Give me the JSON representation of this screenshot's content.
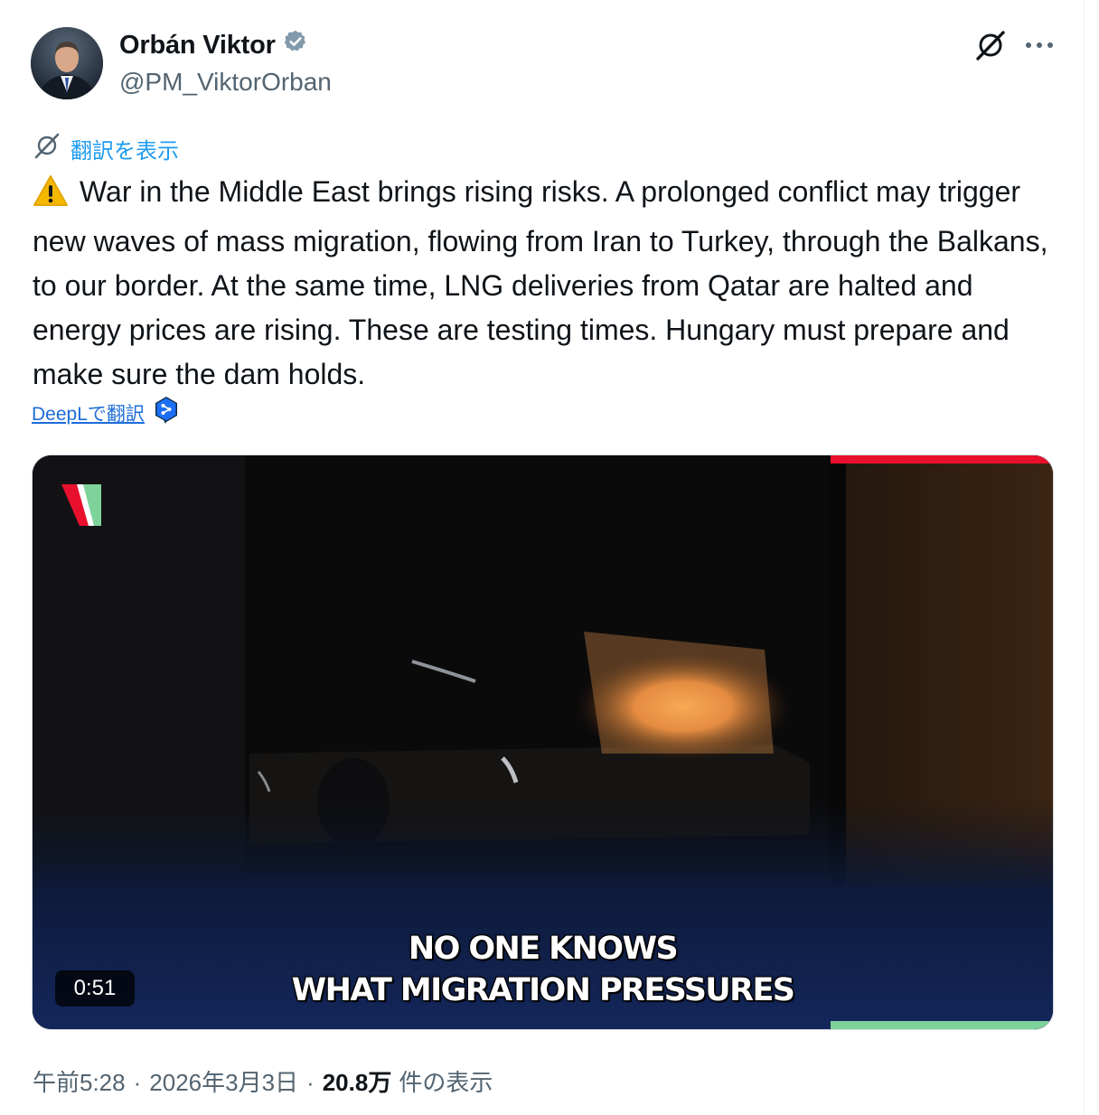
{
  "author": {
    "display_name": "Orbán Viktor",
    "handle": "@PM_ViktorOrban",
    "verified": true,
    "verified_color": "#829aab"
  },
  "header": {
    "grok_icon": "grok-icon",
    "more_icon": "more-dots-icon"
  },
  "translate": {
    "label": "翻訳を表示",
    "icon": "grok-icon"
  },
  "tweet": {
    "emoji": "warning-icon",
    "text": "War in the Middle East brings rising risks. A prolonged conflict may trigger new waves of mass migration, flowing from Iran to Turkey, through the Balkans, to our border. At the same time, LNG deliveries from Qatar are halted and energy prices are rising. These are testing times. Hungary must prepare and make sure the dam holds."
  },
  "deepl": {
    "label": "DeepLで翻訳",
    "icon": "deepl-icon"
  },
  "video": {
    "duration": "0:51",
    "caption_line1": "NO ONE KNOWS",
    "caption_line2": "WHAT MIGRATION PRESSURES",
    "accent_red": "#e8102c",
    "accent_green": "#7ed39a",
    "logo_icon": "channel-logo-icon"
  },
  "meta": {
    "time": "午前5:28",
    "date": "2026年3月3日",
    "views_count": "20.8万",
    "views_label": "件の表示",
    "separator": "·"
  },
  "colors": {
    "link_blue": "#1d9bf0",
    "secondary_text": "#536471",
    "primary_text": "#0f1419"
  }
}
